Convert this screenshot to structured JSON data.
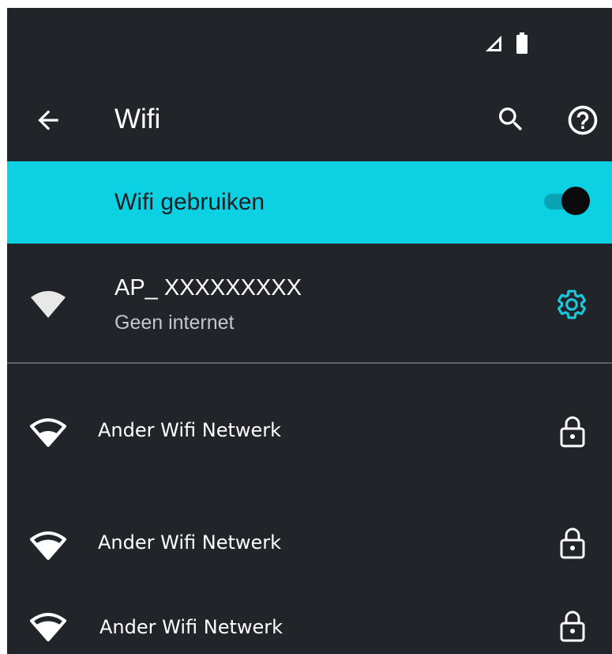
{
  "header": {
    "title": "Wifi"
  },
  "toggle": {
    "label": "Wifi gebruiken",
    "on": true
  },
  "connected": {
    "ssid": "AP_ XXXXXXXXX",
    "status": "Geen internet"
  },
  "networks": [
    {
      "label": "Ander Wifi Netwerk",
      "secured": true
    },
    {
      "label": "Ander Wifi Netwerk",
      "secured": true
    },
    {
      "label": "Ander Wifi Netwerk",
      "secured": true
    }
  ],
  "colors": {
    "background": "#212429",
    "accent": "#0cd1e3",
    "text": "#ffffff",
    "subtext": "#c4c7cc"
  },
  "icons": [
    "signal-icon",
    "battery-icon",
    "back-arrow-icon",
    "search-icon",
    "help-icon",
    "wifi-full-icon",
    "gear-icon",
    "wifi-outline-icon",
    "wifi-icon",
    "lock-icon"
  ]
}
